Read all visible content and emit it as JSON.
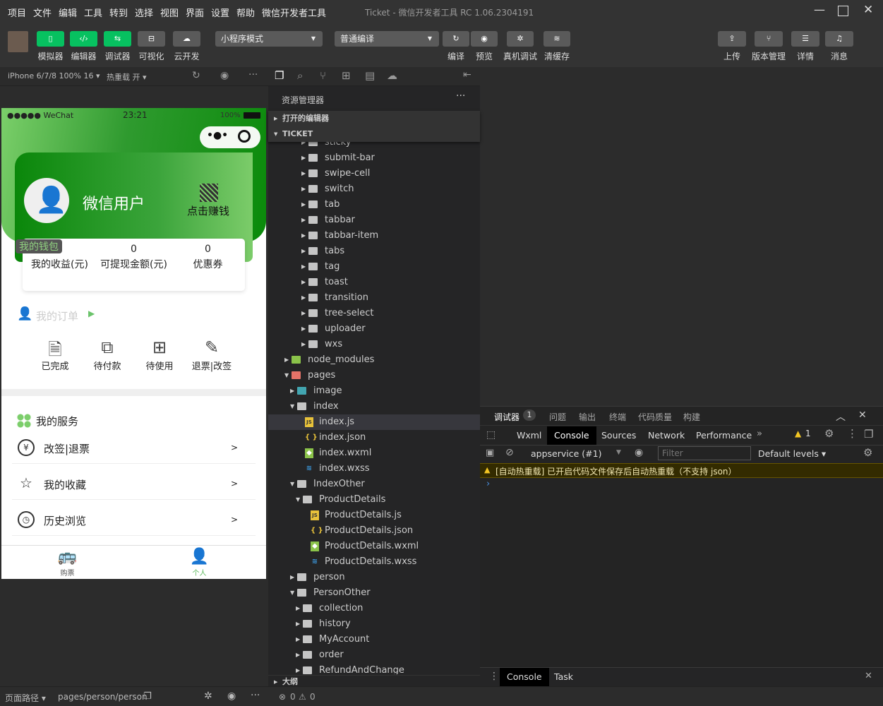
{
  "menu": [
    "项目",
    "文件",
    "编辑",
    "工具",
    "转到",
    "选择",
    "视图",
    "界面",
    "设置",
    "帮助",
    "微信开发者工具"
  ],
  "window_title": "Ticket - 微信开发者工具 RC 1.06.2304191",
  "toolbar": {
    "left_buttons": [
      {
        "label": "模拟器",
        "icon": "phone-icon",
        "active": true
      },
      {
        "label": "编辑器",
        "icon": "code-icon",
        "active": true
      },
      {
        "label": "调试器",
        "icon": "debug-sliders-icon",
        "active": true
      },
      {
        "label": "可视化",
        "icon": "layout-icon",
        "active": false
      },
      {
        "label": "云开发",
        "icon": "cloud-icon",
        "active": false
      }
    ],
    "mode_select": "小程序模式",
    "compile_select": "普通编译",
    "mid_buttons": [
      {
        "label": "编译",
        "icon": "refresh-icon"
      },
      {
        "label": "预览",
        "icon": "eye-icon"
      },
      {
        "label": "真机调试",
        "icon": "bug-icon"
      },
      {
        "label": "清缓存",
        "icon": "layers-icon"
      }
    ],
    "right_buttons": [
      {
        "label": "上传",
        "icon": "upload-icon"
      },
      {
        "label": "版本管理",
        "icon": "branch-icon"
      },
      {
        "label": "详情",
        "icon": "menu-icon"
      },
      {
        "label": "消息",
        "icon": "bell-icon"
      }
    ]
  },
  "simulator": {
    "device": "iPhone 6/7/8 100% 16 ▾",
    "hot_reload": "热重载 开 ▾"
  },
  "phone": {
    "status_left": "●●●●● WeChat",
    "time": "23:21",
    "battery": "100%",
    "username": "微信用户",
    "qr_label": "点击赚钱",
    "wallet_tag": "我的钱包",
    "wallet": [
      {
        "value": "0",
        "label": "我的收益(元)"
      },
      {
        "value": "0",
        "label": "可提现金额(元)"
      },
      {
        "value": "0",
        "label": "优惠券"
      }
    ],
    "orders_title": "我的订单",
    "orders": [
      {
        "label": "已完成",
        "icon": "document-icon"
      },
      {
        "label": "待付款",
        "icon": "payment-icon"
      },
      {
        "label": "待使用",
        "icon": "box-icon"
      },
      {
        "label": "退票|改签",
        "icon": "edit-icon"
      }
    ],
    "services_title": "我的服务",
    "services": [
      {
        "label": "改签|退票",
        "icon": "yen-refresh-icon",
        "chevron": ">"
      },
      {
        "label": "我的收藏",
        "icon": "star-icon",
        "chevron": ">"
      },
      {
        "label": "历史浏览",
        "icon": "clock-icon",
        "chevron": ">"
      }
    ],
    "tabbar": [
      {
        "label": "购票",
        "icon": "bus-icon",
        "active": false
      },
      {
        "label": "个人",
        "icon": "person-icon",
        "active": true
      }
    ],
    "accent": "#5cb85c"
  },
  "explorer": {
    "title": "资源管理器",
    "open_editors": "打开的编辑器",
    "project": "TICKET",
    "outline": "大纲",
    "items": [
      {
        "name": "sticky",
        "d": 3,
        "type": "folder"
      },
      {
        "name": "submit-bar",
        "d": 3,
        "type": "folder"
      },
      {
        "name": "swipe-cell",
        "d": 3,
        "type": "folder"
      },
      {
        "name": "switch",
        "d": 3,
        "type": "folder"
      },
      {
        "name": "tab",
        "d": 3,
        "type": "folder"
      },
      {
        "name": "tabbar",
        "d": 3,
        "type": "folder"
      },
      {
        "name": "tabbar-item",
        "d": 3,
        "type": "folder"
      },
      {
        "name": "tabs",
        "d": 3,
        "type": "folder"
      },
      {
        "name": "tag",
        "d": 3,
        "type": "folder"
      },
      {
        "name": "toast",
        "d": 3,
        "type": "folder"
      },
      {
        "name": "transition",
        "d": 3,
        "type": "folder"
      },
      {
        "name": "tree-select",
        "d": 3,
        "type": "folder"
      },
      {
        "name": "uploader",
        "d": 3,
        "type": "folder"
      },
      {
        "name": "wxs",
        "d": 3,
        "type": "folder"
      },
      {
        "name": "node_modules",
        "d": 0,
        "type": "folder",
        "color": "#8bc34a"
      },
      {
        "name": "pages",
        "d": 0,
        "type": "folder",
        "open": true,
        "color": "#e57368"
      },
      {
        "name": "image",
        "d": 1,
        "type": "folder",
        "color": "#42a5b0"
      },
      {
        "name": "index",
        "d": 1,
        "type": "folder",
        "open": true
      },
      {
        "name": "index.js",
        "d": 2,
        "type": "js",
        "selected": true
      },
      {
        "name": "index.json",
        "d": 2,
        "type": "json"
      },
      {
        "name": "index.wxml",
        "d": 2,
        "type": "wxml"
      },
      {
        "name": "index.wxss",
        "d": 2,
        "type": "wxss"
      },
      {
        "name": "IndexOther",
        "d": 1,
        "type": "folder",
        "open": true
      },
      {
        "name": "ProductDetails",
        "d": 2,
        "type": "folder",
        "open": true
      },
      {
        "name": "ProductDetails.js",
        "d": 3,
        "type": "js"
      },
      {
        "name": "ProductDetails.json",
        "d": 3,
        "type": "json"
      },
      {
        "name": "ProductDetails.wxml",
        "d": 3,
        "type": "wxml"
      },
      {
        "name": "ProductDetails.wxss",
        "d": 3,
        "type": "wxss"
      },
      {
        "name": "person",
        "d": 1,
        "type": "folder"
      },
      {
        "name": "PersonOther",
        "d": 1,
        "type": "folder",
        "open": true
      },
      {
        "name": "collection",
        "d": 2,
        "type": "folder"
      },
      {
        "name": "history",
        "d": 2,
        "type": "folder"
      },
      {
        "name": "MyAccount",
        "d": 2,
        "type": "folder"
      },
      {
        "name": "order",
        "d": 2,
        "type": "folder"
      },
      {
        "name": "RefundAndChange",
        "d": 2,
        "type": "folder"
      }
    ]
  },
  "debugger": {
    "tabs": [
      "调试器",
      "问题",
      "输出",
      "终端",
      "代码质量",
      "构建"
    ],
    "badge": "1",
    "devtools_tabs": [
      "Wxml",
      "Console",
      "Sources",
      "Network",
      "Performance"
    ],
    "active_devtab": "Console",
    "more": "»",
    "warnings": "1",
    "context": "appservice (#1)",
    "filter_placeholder": "Filter",
    "levels": "Default levels ▾",
    "message": "[自动热重载] 已开启代码文件保存后自动热重载（不支持 json）",
    "prompt": "›",
    "bottom_tabs": [
      "Console",
      "Task"
    ]
  },
  "status": {
    "path_label": "页面路径 ▾",
    "path": "pages/person/person",
    "errors": "0",
    "warnings": "0"
  }
}
